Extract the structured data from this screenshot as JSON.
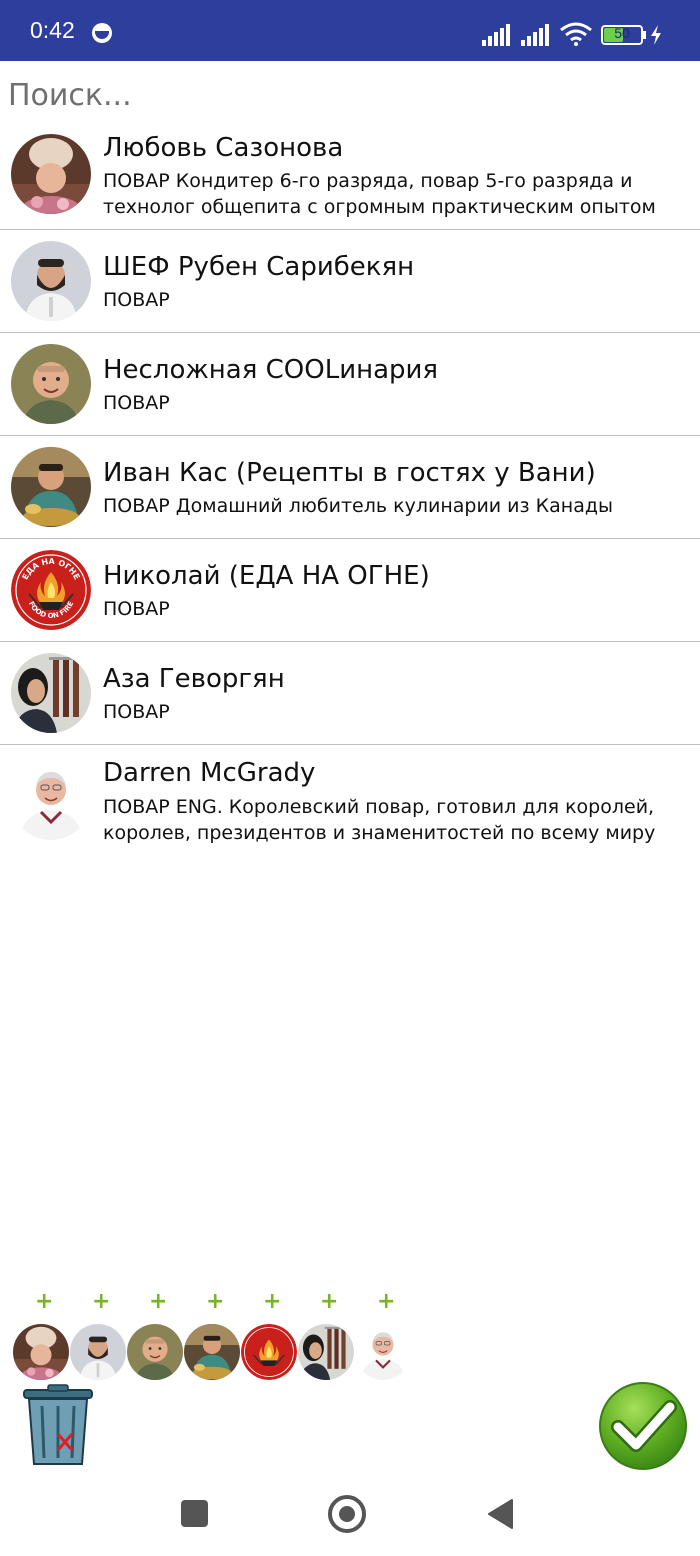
{
  "status_bar": {
    "time": "0:42",
    "battery_level": "50",
    "icons": [
      "face-icon",
      "signal-icon",
      "signal-icon",
      "wifi-icon",
      "battery-icon",
      "charging-icon"
    ]
  },
  "search": {
    "value": "",
    "placeholder": "Поиск..."
  },
  "chefs": [
    {
      "name": "Любовь Сазонова",
      "description": "ПОВАР  Кондитер 6-го разряда, повар 5-го разряда и технолог общепита с огромным практическим опытом",
      "avatar": "chef-woman-avatar"
    },
    {
      "name": "ШЕФ Рубен Сарибекян",
      "description": "ПОВАР",
      "avatar": "chef-bearded-man-avatar"
    },
    {
      "name": "Несложная COOLинария",
      "description": "ПОВАР",
      "avatar": "smiling-man-avatar"
    },
    {
      "name": "Иван Кас (Рецепты в гостях у Вани)",
      "description": "ПОВАР  Домашний любитель кулинарии из Канады",
      "avatar": "cooking-man-avatar"
    },
    {
      "name": "Николай (ЕДА НА ОГНЕ)",
      "description": "ПОВАР",
      "avatar": "food-on-fire-logo"
    },
    {
      "name": "Аза Геворгян",
      "description": "ПОВАР",
      "avatar": "woman-with-sausages-avatar"
    },
    {
      "name": "Darren McGrady",
      "description": "ПОВАР  ENG. Королевский повар, готовил для королей, королев, президентов и знаменитостей по всему миру",
      "avatar": "royal-chef-avatar"
    }
  ],
  "selected": {
    "add_symbol": "+",
    "count": 7
  },
  "actions": {
    "delete_icon": "trash-icon",
    "confirm_icon": "checkmark-icon"
  },
  "logo_text": {
    "top": "ЕДА НА ОГНЕ",
    "bottom": "FOOD ON FIRE"
  },
  "colors": {
    "status_bar": "#2d3e9c",
    "accent_green": "#7ab32a",
    "divider": "#bdbdbd"
  }
}
